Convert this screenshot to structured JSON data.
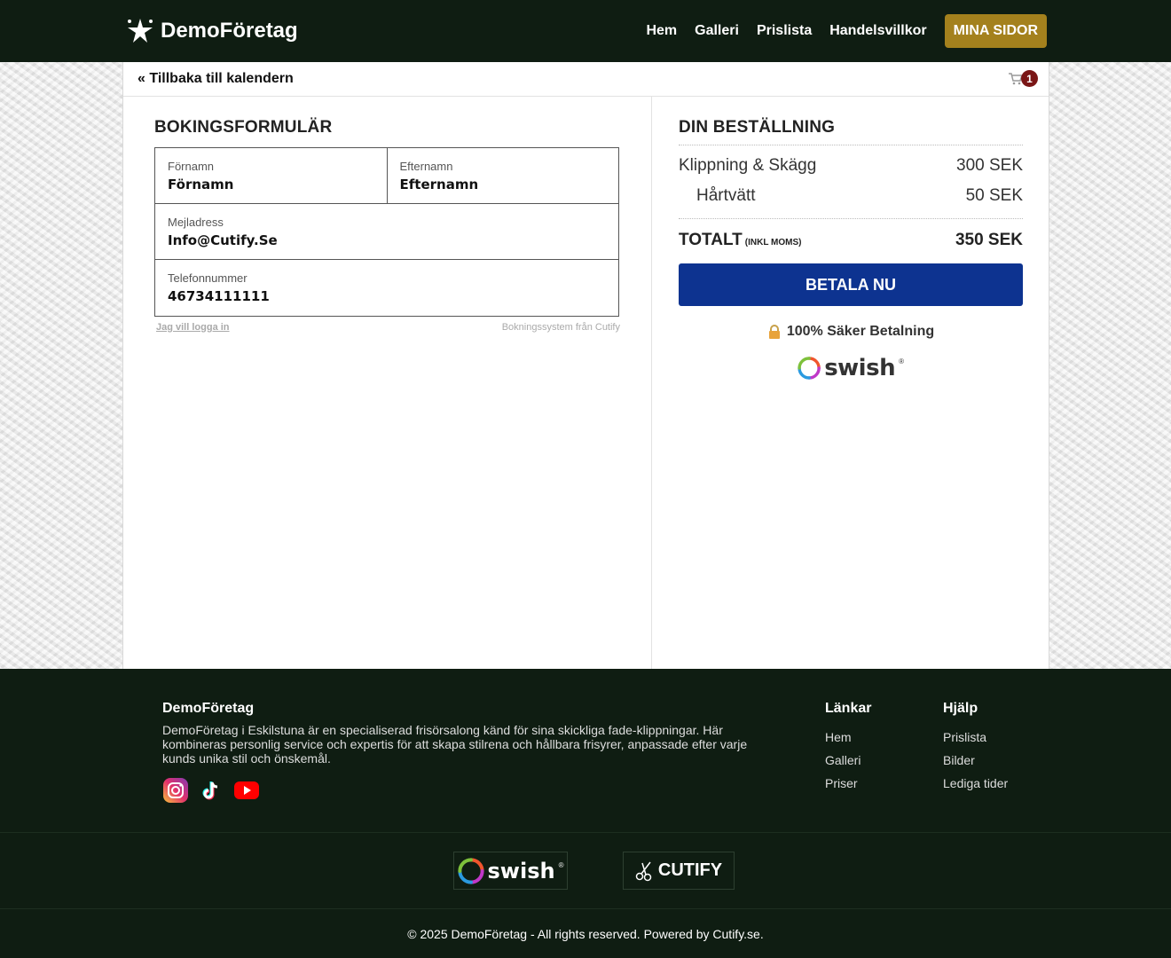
{
  "header": {
    "brand": "DemoFöretag",
    "nav": [
      "Hem",
      "Galleri",
      "Prislista",
      "Handelsvillkor"
    ],
    "mina_sidor": "MINA SIDOR"
  },
  "topbar": {
    "back_label": "« Tillbaka till kalendern",
    "cart_count": "1"
  },
  "form": {
    "title": "BOKINGSFORMULÄR",
    "first_name_label": "Förnamn",
    "first_name_value": "Förnamn",
    "last_name_label": "Efternamn",
    "last_name_value": "Efternamn",
    "email_label": "Mejladress",
    "email_value": "Info@Cutify.Se",
    "phone_label": "Telefonnummer",
    "phone_value": "46734111111",
    "login_link": "Jag vill logga in",
    "powered": "Bokningssystem från Cutify"
  },
  "order": {
    "title": "DIN BESTÄLLNING",
    "items": [
      {
        "name": "Klippning & Skägg",
        "price": "300 SEK"
      },
      {
        "name": "Hårtvätt",
        "price": "50 SEK"
      }
    ],
    "total_label": "TOTALT",
    "total_note": "(INKL MOMS)",
    "total_value": "350 SEK",
    "pay_button": "BETALA NU",
    "secure_text": "100% Säker Betalning",
    "swish_word": "swish",
    "swish_reg": "®"
  },
  "footer": {
    "brand": "DemoFöretag",
    "description": "DemoFöretag i Eskilstuna är en specialiserad frisörsalong känd för sina skickliga fade-klippningar. Här kombineras personlig service och expertis för att skapa stilrena och hållbara frisyrer, anpassade efter varje kunds unika stil och önskemål.",
    "links_title": "Länkar",
    "links": [
      "Hem",
      "Galleri",
      "Priser"
    ],
    "help_title": "Hjälp",
    "help": [
      "Prislista",
      "Bilder",
      "Lediga tider"
    ],
    "partner_swish": "swish",
    "partner_swish_reg": "®",
    "partner_cutify": "CUTIFY",
    "copyright": "© 2025 DemoFöretag - All rights reserved. Powered by Cutify.se."
  },
  "colors": {
    "header_bg": "#0f1d12",
    "accent_gold": "#a4811d",
    "pay_blue": "#0d3390",
    "badge_red": "#7a1616"
  },
  "icons": {
    "brand": "star-burst-icon",
    "cart": "cart-icon",
    "lock": "lock-icon",
    "instagram": "instagram-icon",
    "tiktok": "tiktok-icon",
    "youtube": "youtube-icon",
    "scissors": "scissors-icon"
  }
}
